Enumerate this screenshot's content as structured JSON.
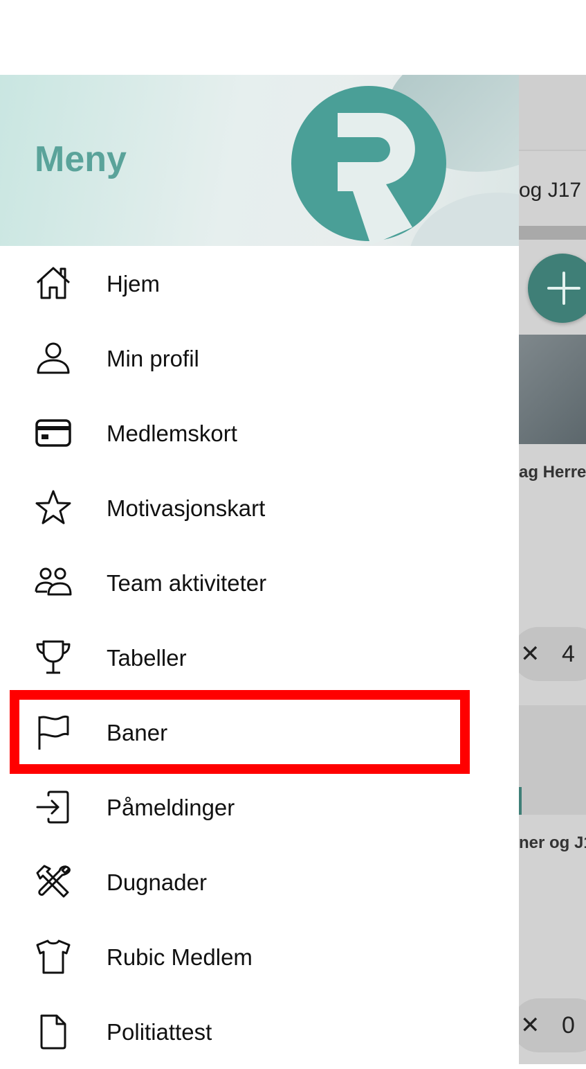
{
  "background_app": {
    "tab_text": "og J17",
    "fab_icon": "plus-icon",
    "card1_title": "ag Herre",
    "card1_chip": {
      "icon": "close-icon",
      "count": "4"
    },
    "card2_title": "ner og J1",
    "card2_chip": {
      "icon": "close-icon",
      "count": "0"
    }
  },
  "drawer": {
    "title": "Meny",
    "logo": "rubic-logo",
    "accent_color": "#4a9f97",
    "items": [
      {
        "label": "Hjem",
        "icon": "home-icon"
      },
      {
        "label": "Min profil",
        "icon": "user-icon"
      },
      {
        "label": "Medlemskort",
        "icon": "card-icon"
      },
      {
        "label": "Motivasjonskart",
        "icon": "star-icon"
      },
      {
        "label": "Team aktiviteter",
        "icon": "team-icon"
      },
      {
        "label": "Tabeller",
        "icon": "trophy-icon"
      },
      {
        "label": "Baner",
        "icon": "flag-icon"
      },
      {
        "label": "Påmeldinger",
        "icon": "login-icon",
        "highlighted": true
      },
      {
        "label": "Dugnader",
        "icon": "tools-icon"
      },
      {
        "label": "Rubic Medlem",
        "icon": "shirt-icon"
      },
      {
        "label": "Politiattest",
        "icon": "document-icon"
      }
    ]
  },
  "highlight_color": "#ff0000"
}
